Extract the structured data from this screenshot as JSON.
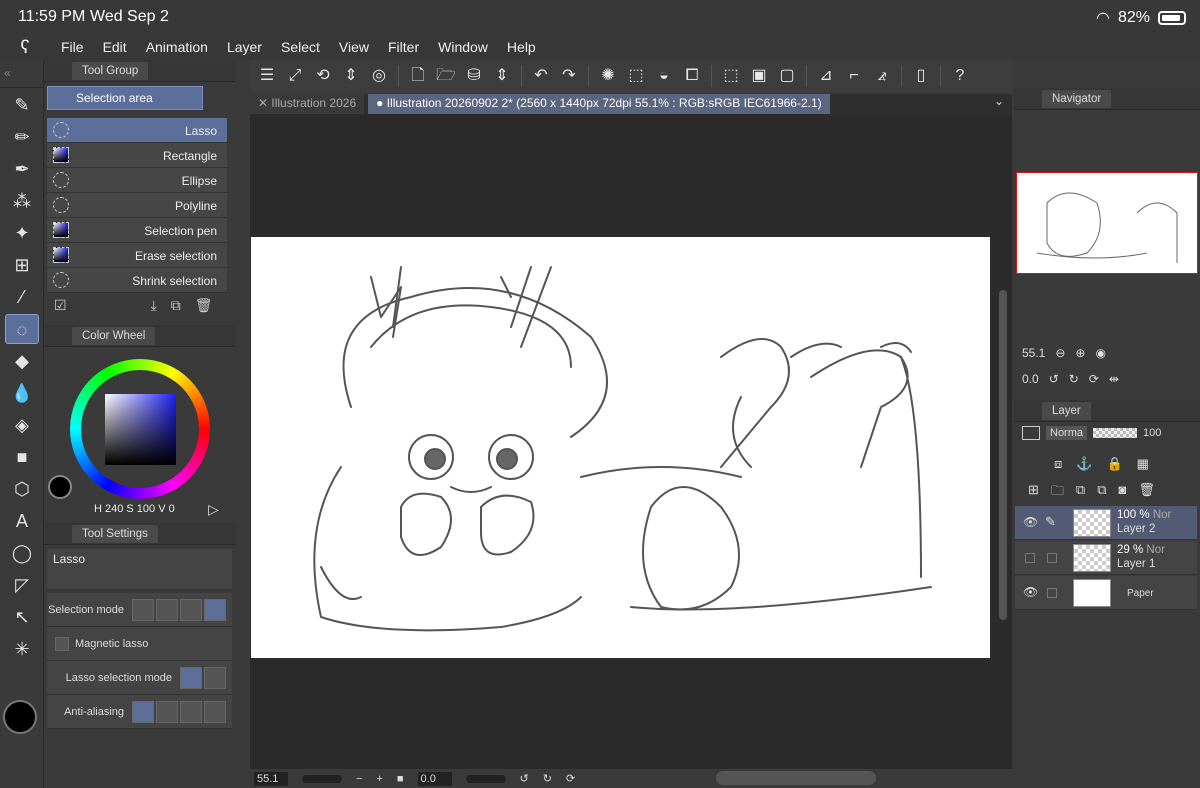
{
  "status": {
    "time": "11:59 PM",
    "date": "Wed Sep 2",
    "battery": "82%"
  },
  "menu": [
    "File",
    "Edit",
    "Animation",
    "Layer",
    "Select",
    "View",
    "Filter",
    "Window",
    "Help"
  ],
  "toolgroup": {
    "tab": "Tool Group",
    "group": "Selection area",
    "items": [
      "Lasso",
      "Rectangle",
      "Ellipse",
      "Polyline",
      "Selection pen",
      "Erase selection",
      "Shrink selection"
    ]
  },
  "colorwheel": {
    "tab": "Color Wheel",
    "hsv": "H 240 S 100 V  0",
    "main_color": "#000000",
    "sub_color": "#6fb0ff"
  },
  "toolsettings": {
    "tab": "Tool Settings",
    "tool": "Lasso",
    "selection_mode": "Selection mode",
    "magnetic": "Magnetic lasso",
    "lasso_mode": "Lasso selection mode",
    "antialias": "Anti-aliasing"
  },
  "tabs": {
    "inactive": "Illustration 2026",
    "active": "Illustration 20260902 2* (2560 x 1440px 72dpi 55.1% : RGB:sRGB IEC61966-2.1)"
  },
  "bottom": {
    "zoom": "55.1",
    "rotate": "0.0"
  },
  "navigator": {
    "tab": "Navigator",
    "zoom": "55.1",
    "rotate": "0.0"
  },
  "layerpanel": {
    "tab": "Layer",
    "blend": "Norma",
    "opacity": "100",
    "layers": [
      {
        "pct": "100 %",
        "blend": "Nor",
        "name": "Layer 2"
      },
      {
        "pct": "29 %",
        "blend": "Nor",
        "name": "Layer 1"
      },
      {
        "pct": "",
        "blend": "",
        "name": "Paper"
      }
    ]
  }
}
